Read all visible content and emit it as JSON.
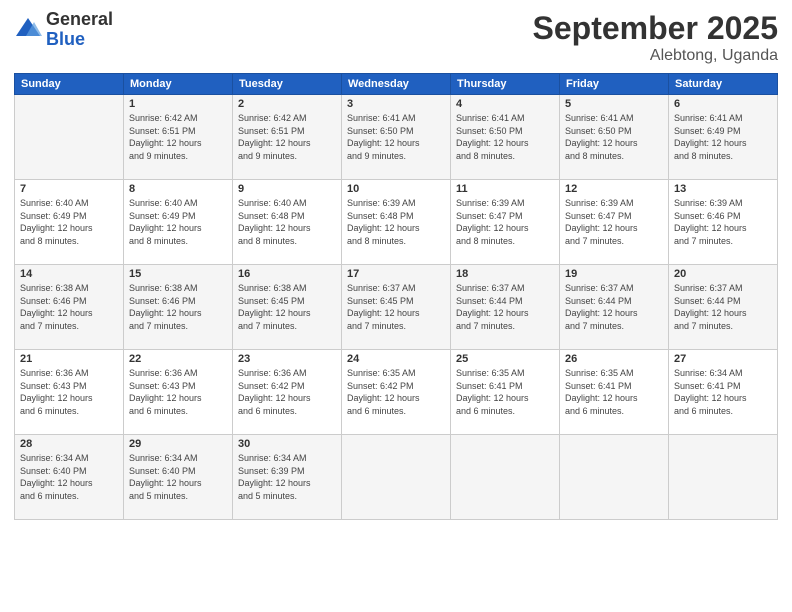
{
  "logo": {
    "general": "General",
    "blue": "Blue"
  },
  "title": "September 2025",
  "subtitle": "Alebtong, Uganda",
  "days_header": [
    "Sunday",
    "Monday",
    "Tuesday",
    "Wednesday",
    "Thursday",
    "Friday",
    "Saturday"
  ],
  "weeks": [
    [
      {
        "num": "",
        "info": ""
      },
      {
        "num": "1",
        "info": "Sunrise: 6:42 AM\nSunset: 6:51 PM\nDaylight: 12 hours\nand 9 minutes."
      },
      {
        "num": "2",
        "info": "Sunrise: 6:42 AM\nSunset: 6:51 PM\nDaylight: 12 hours\nand 9 minutes."
      },
      {
        "num": "3",
        "info": "Sunrise: 6:41 AM\nSunset: 6:50 PM\nDaylight: 12 hours\nand 9 minutes."
      },
      {
        "num": "4",
        "info": "Sunrise: 6:41 AM\nSunset: 6:50 PM\nDaylight: 12 hours\nand 8 minutes."
      },
      {
        "num": "5",
        "info": "Sunrise: 6:41 AM\nSunset: 6:50 PM\nDaylight: 12 hours\nand 8 minutes."
      },
      {
        "num": "6",
        "info": "Sunrise: 6:41 AM\nSunset: 6:49 PM\nDaylight: 12 hours\nand 8 minutes."
      }
    ],
    [
      {
        "num": "7",
        "info": "Sunrise: 6:40 AM\nSunset: 6:49 PM\nDaylight: 12 hours\nand 8 minutes."
      },
      {
        "num": "8",
        "info": "Sunrise: 6:40 AM\nSunset: 6:49 PM\nDaylight: 12 hours\nand 8 minutes."
      },
      {
        "num": "9",
        "info": "Sunrise: 6:40 AM\nSunset: 6:48 PM\nDaylight: 12 hours\nand 8 minutes."
      },
      {
        "num": "10",
        "info": "Sunrise: 6:39 AM\nSunset: 6:48 PM\nDaylight: 12 hours\nand 8 minutes."
      },
      {
        "num": "11",
        "info": "Sunrise: 6:39 AM\nSunset: 6:47 PM\nDaylight: 12 hours\nand 8 minutes."
      },
      {
        "num": "12",
        "info": "Sunrise: 6:39 AM\nSunset: 6:47 PM\nDaylight: 12 hours\nand 7 minutes."
      },
      {
        "num": "13",
        "info": "Sunrise: 6:39 AM\nSunset: 6:46 PM\nDaylight: 12 hours\nand 7 minutes."
      }
    ],
    [
      {
        "num": "14",
        "info": "Sunrise: 6:38 AM\nSunset: 6:46 PM\nDaylight: 12 hours\nand 7 minutes."
      },
      {
        "num": "15",
        "info": "Sunrise: 6:38 AM\nSunset: 6:46 PM\nDaylight: 12 hours\nand 7 minutes."
      },
      {
        "num": "16",
        "info": "Sunrise: 6:38 AM\nSunset: 6:45 PM\nDaylight: 12 hours\nand 7 minutes."
      },
      {
        "num": "17",
        "info": "Sunrise: 6:37 AM\nSunset: 6:45 PM\nDaylight: 12 hours\nand 7 minutes."
      },
      {
        "num": "18",
        "info": "Sunrise: 6:37 AM\nSunset: 6:44 PM\nDaylight: 12 hours\nand 7 minutes."
      },
      {
        "num": "19",
        "info": "Sunrise: 6:37 AM\nSunset: 6:44 PM\nDaylight: 12 hours\nand 7 minutes."
      },
      {
        "num": "20",
        "info": "Sunrise: 6:37 AM\nSunset: 6:44 PM\nDaylight: 12 hours\nand 7 minutes."
      }
    ],
    [
      {
        "num": "21",
        "info": "Sunrise: 6:36 AM\nSunset: 6:43 PM\nDaylight: 12 hours\nand 6 minutes."
      },
      {
        "num": "22",
        "info": "Sunrise: 6:36 AM\nSunset: 6:43 PM\nDaylight: 12 hours\nand 6 minutes."
      },
      {
        "num": "23",
        "info": "Sunrise: 6:36 AM\nSunset: 6:42 PM\nDaylight: 12 hours\nand 6 minutes."
      },
      {
        "num": "24",
        "info": "Sunrise: 6:35 AM\nSunset: 6:42 PM\nDaylight: 12 hours\nand 6 minutes."
      },
      {
        "num": "25",
        "info": "Sunrise: 6:35 AM\nSunset: 6:41 PM\nDaylight: 12 hours\nand 6 minutes."
      },
      {
        "num": "26",
        "info": "Sunrise: 6:35 AM\nSunset: 6:41 PM\nDaylight: 12 hours\nand 6 minutes."
      },
      {
        "num": "27",
        "info": "Sunrise: 6:34 AM\nSunset: 6:41 PM\nDaylight: 12 hours\nand 6 minutes."
      }
    ],
    [
      {
        "num": "28",
        "info": "Sunrise: 6:34 AM\nSunset: 6:40 PM\nDaylight: 12 hours\nand 6 minutes."
      },
      {
        "num": "29",
        "info": "Sunrise: 6:34 AM\nSunset: 6:40 PM\nDaylight: 12 hours\nand 5 minutes."
      },
      {
        "num": "30",
        "info": "Sunrise: 6:34 AM\nSunset: 6:39 PM\nDaylight: 12 hours\nand 5 minutes."
      },
      {
        "num": "",
        "info": ""
      },
      {
        "num": "",
        "info": ""
      },
      {
        "num": "",
        "info": ""
      },
      {
        "num": "",
        "info": ""
      }
    ]
  ]
}
